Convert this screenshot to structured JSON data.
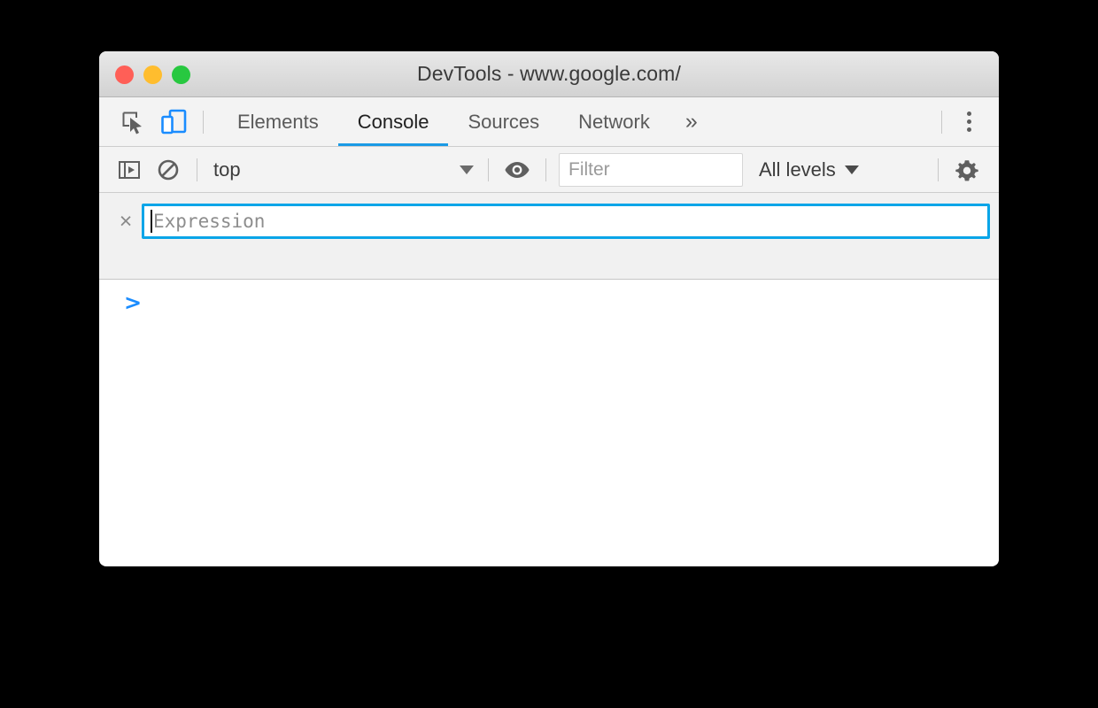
{
  "window": {
    "title": "DevTools - www.google.com/",
    "traffic_lights": [
      {
        "name": "close",
        "color": "#ff5f57"
      },
      {
        "name": "minimize",
        "color": "#ffbd2e"
      },
      {
        "name": "zoom",
        "color": "#28c840"
      }
    ]
  },
  "tabbar": {
    "inspect_icon": "inspect-element-icon",
    "device_toolbar_icon": "device-toolbar-icon",
    "tabs": [
      {
        "label": "Elements",
        "active": false
      },
      {
        "label": "Console",
        "active": true
      },
      {
        "label": "Sources",
        "active": false
      },
      {
        "label": "Network",
        "active": false
      }
    ],
    "more_tabs": "»",
    "main_menu_icon": "three-dot-menu-icon"
  },
  "console_toolbar": {
    "sidebar_icon": "console-sidebar-icon",
    "clear_icon": "clear-console-icon",
    "context": {
      "value": "top",
      "caret": "▼"
    },
    "eye_icon": "create-live-expression-icon",
    "filter": {
      "value": "",
      "placeholder": "Filter"
    },
    "levels": {
      "value": "All levels",
      "caret": "▼"
    },
    "settings_icon": "settings-gear-icon"
  },
  "live_expression": {
    "close_label": "×",
    "value": "",
    "placeholder": "Expression"
  },
  "console": {
    "prompt": ">",
    "messages": []
  },
  "colors": {
    "accent_blue": "#1a9ae5",
    "focus_blue": "#0aa5e8",
    "prompt_blue": "#1a8cff",
    "toolbar_bg": "#f3f3f3",
    "live_pane_bg": "#f1f1f1"
  }
}
